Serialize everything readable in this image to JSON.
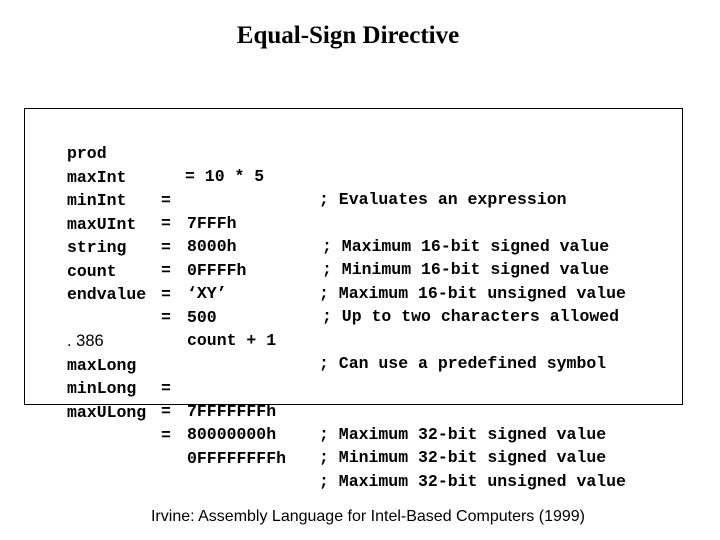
{
  "title": "Equal-Sign Directive",
  "code": {
    "group1": [
      {
        "name": "prod",
        "eq": "",
        "value": "= 10 * 5",
        "comment": "; Evaluates an expression"
      },
      {
        "name": "maxInt",
        "eq": "=",
        "value": "7FFFh",
        "comment": "; Maximum 16-bit signed value"
      },
      {
        "name": "minInt",
        "eq": "=",
        "value": "8000h",
        "comment": "; Minimum 16-bit signed value"
      },
      {
        "name": "maxUInt",
        "eq": "=",
        "value": "0FFFFh",
        "comment": "; Maximum 16-bit unsigned value"
      },
      {
        "name": "string",
        "eq": "=",
        "value": "‘XY’",
        "comment": "; Up to two characters allowed"
      },
      {
        "name": "count",
        "eq": "=",
        "value": "500",
        "comment": ""
      },
      {
        "name": "endvalue",
        "eq": "=",
        "value": "count + 1",
        "comment": "; Can use a predefined symbol"
      }
    ],
    "directive": ". 386",
    "group2": [
      {
        "name": "maxLong",
        "eq": "=",
        "value": "7FFFFFFFh",
        "comment": "; Maximum 32-bit signed value"
      },
      {
        "name": "minLong",
        "eq": "=",
        "value": "80000000h",
        "comment": "; Minimum 32-bit signed value"
      },
      {
        "name": "maxULong",
        "eq": "=",
        "value": "0FFFFFFFFh",
        "comment": "; Maximum 32-bit unsigned value"
      }
    ]
  },
  "citation": "Irvine: Assembly Language for Intel-Based Computers (1999)"
}
